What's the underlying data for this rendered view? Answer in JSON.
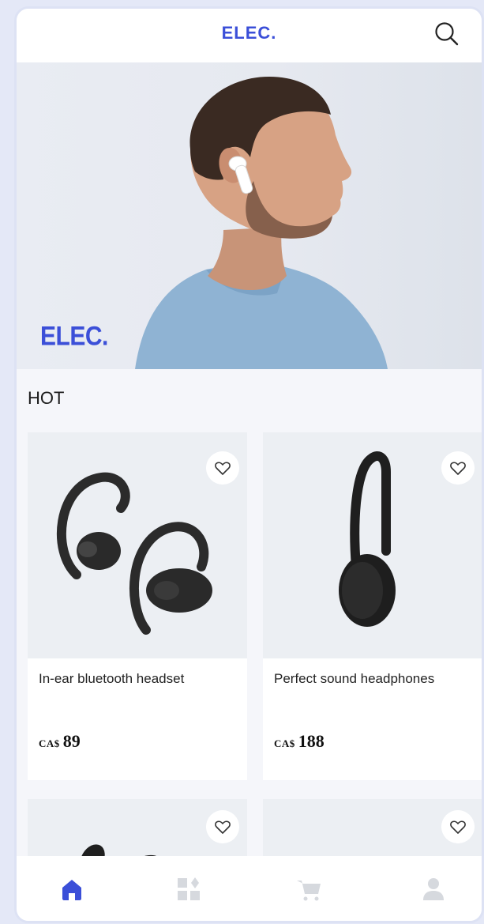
{
  "header": {
    "brand": "ELEC.",
    "search_icon": "search-icon"
  },
  "hero": {
    "logo_text": "ELEC."
  },
  "section": {
    "title": "HOT"
  },
  "products": [
    {
      "name": "In-ear bluetooth headset",
      "currency": "CA$",
      "price": "89"
    },
    {
      "name": "Perfect sound headphones",
      "currency": "CA$",
      "price": "188"
    }
  ],
  "tabbar": {
    "items": [
      {
        "icon": "home-icon",
        "active": true
      },
      {
        "icon": "categories-icon",
        "active": false
      },
      {
        "icon": "cart-icon",
        "active": false
      },
      {
        "icon": "profile-icon",
        "active": false
      }
    ]
  },
  "colors": {
    "accent": "#3b4fd8",
    "inactive_icon": "#d6d9de"
  }
}
